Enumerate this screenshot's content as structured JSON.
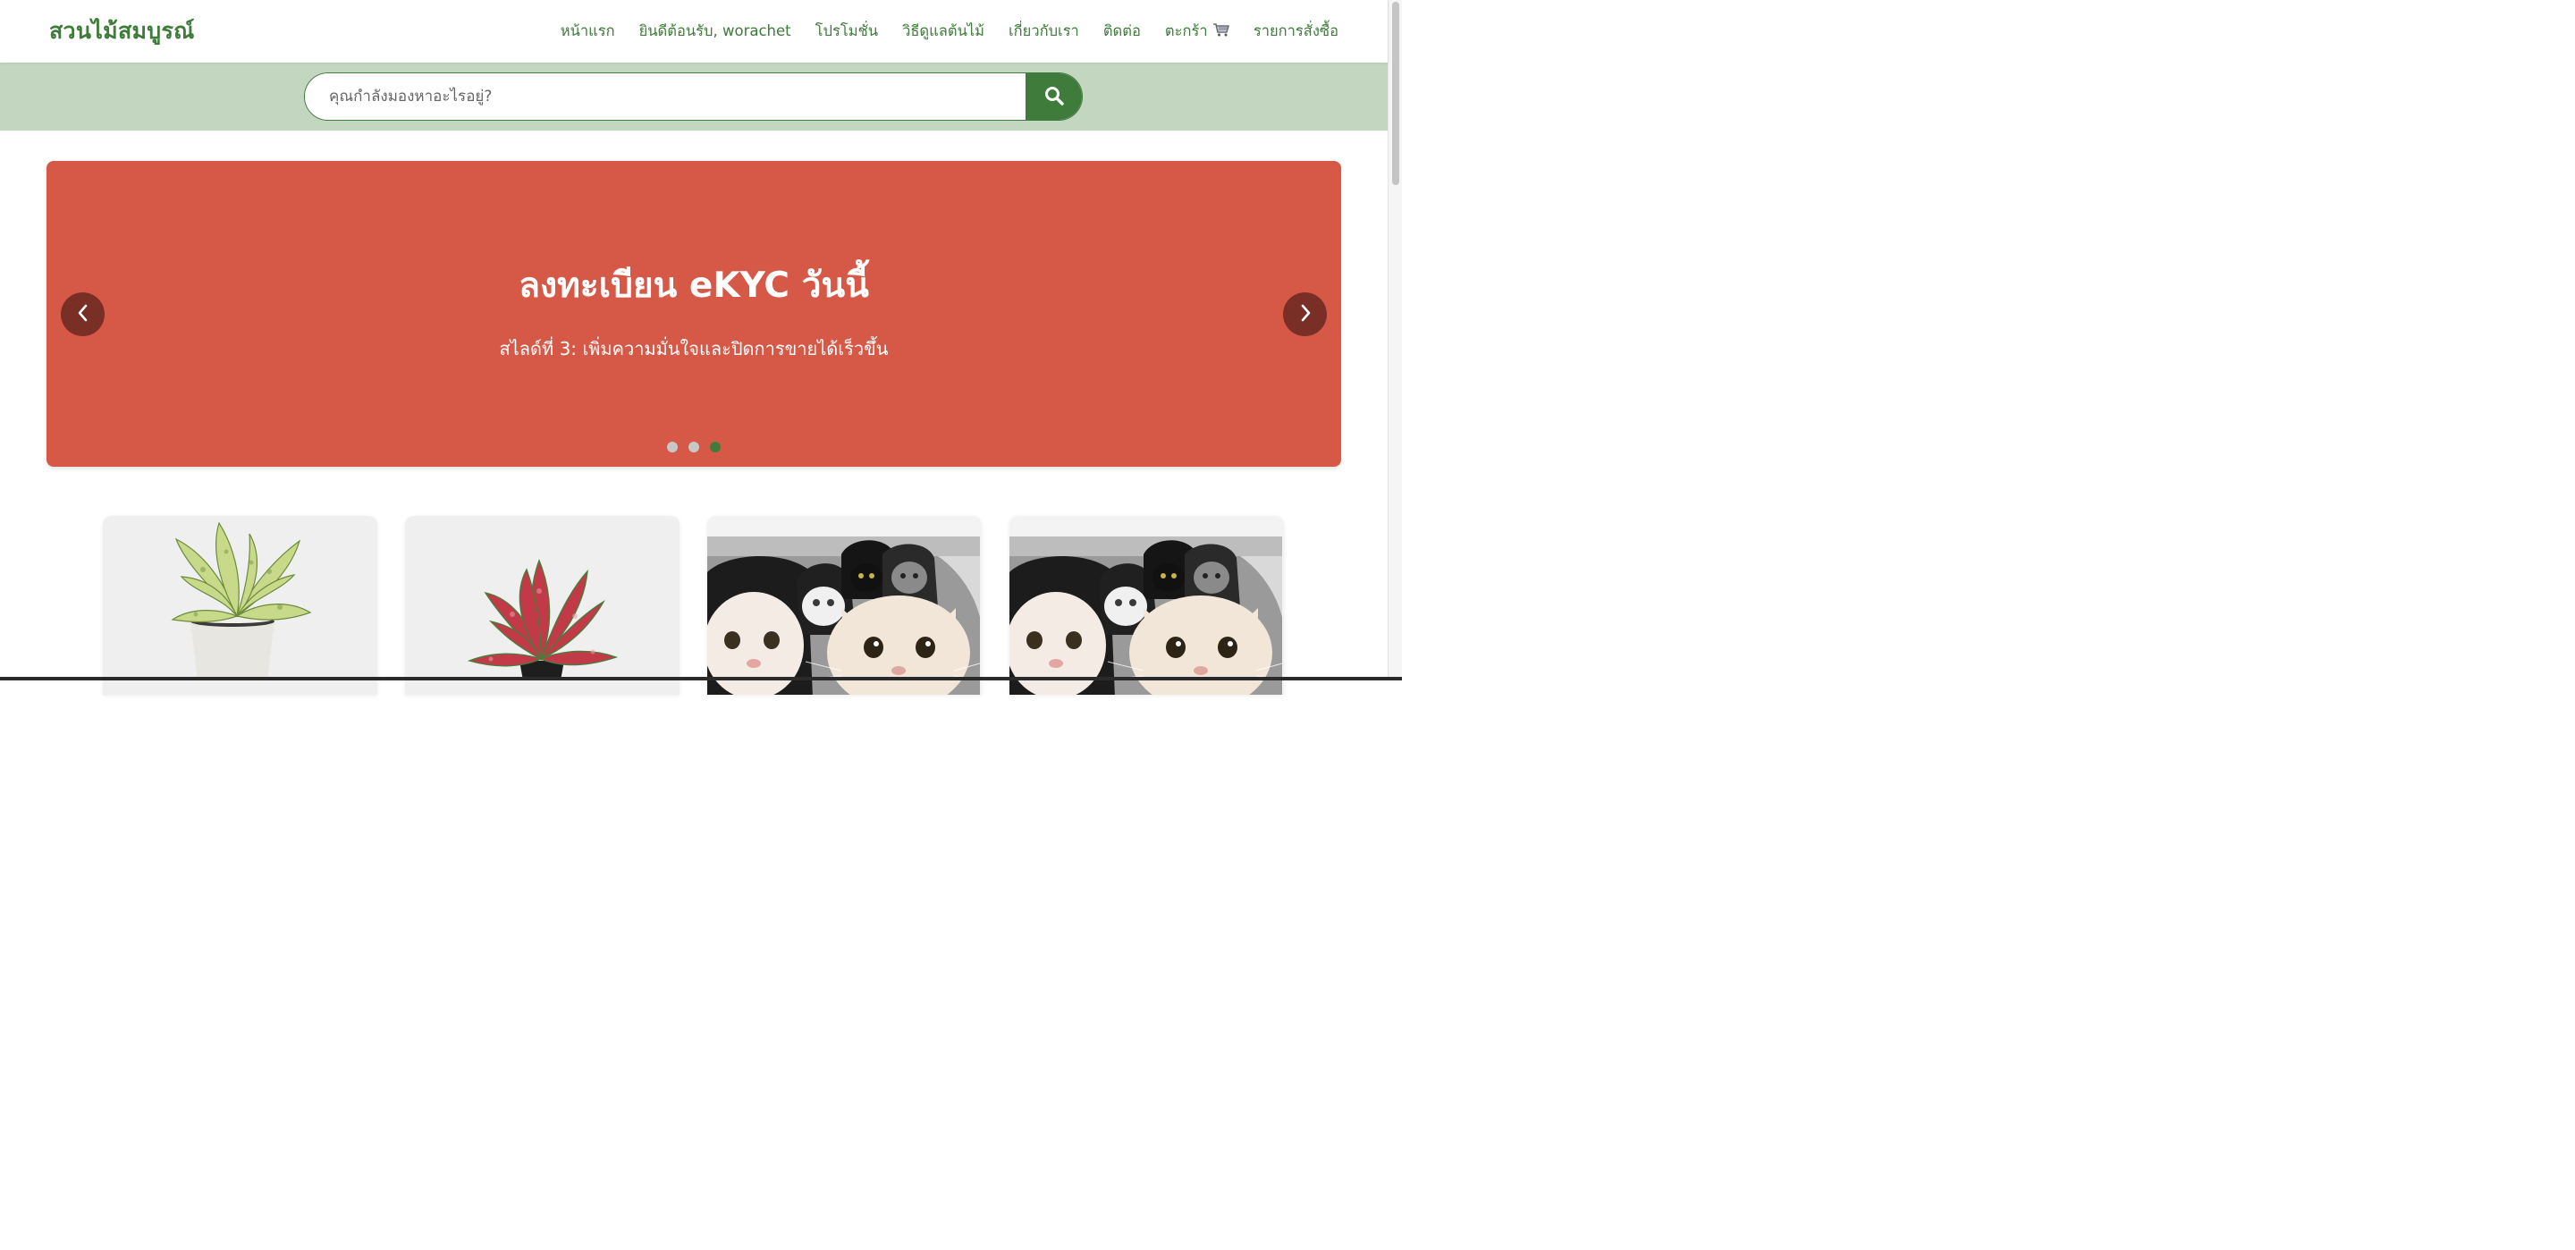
{
  "header": {
    "brand": "สวนไม้สมบูรณ์",
    "nav": [
      {
        "label": "หน้าแรก"
      },
      {
        "label": "ยินดีต้อนรับ, worachet"
      },
      {
        "label": "โปรโมชั่น"
      },
      {
        "label": "วิธีดูแลต้นไม้"
      },
      {
        "label": "เกี่ยวกับเรา"
      },
      {
        "label": "ติดต่อ"
      },
      {
        "label": "ตะกร้า",
        "icon": "cart-icon"
      },
      {
        "label": "รายการสั่งซื้อ"
      }
    ]
  },
  "search": {
    "placeholder": "คุณกำลังมองหาอะไรอยู่?",
    "value": "",
    "button_icon": "search-icon"
  },
  "carousel": {
    "title": "ลงทะเบียน eKYC วันนี้",
    "subtitle": "สไลด์ที่ 3: เพิ่มความมั่นใจและปิดการขายได้เร็วขึ้น",
    "slide_count": 3,
    "active_slide": 3,
    "prev_icon": "chevron-left-icon",
    "next_icon": "chevron-right-icon"
  },
  "products": [
    {
      "image": "variegated-aglaonema-plant-in-white-pot"
    },
    {
      "image": "red-aglaonema-plant-in-black-pot"
    },
    {
      "image": "cats-in-black-hoodies-photo"
    },
    {
      "image": "cats-in-black-hoodies-photo"
    }
  ],
  "colors": {
    "brand_green": "#3f7b3a",
    "search_band": "#c2d6c0",
    "carousel_bg": "#d65847",
    "arrow_bg": "#7a2f26",
    "dot_inactive": "#c8c8c8"
  }
}
